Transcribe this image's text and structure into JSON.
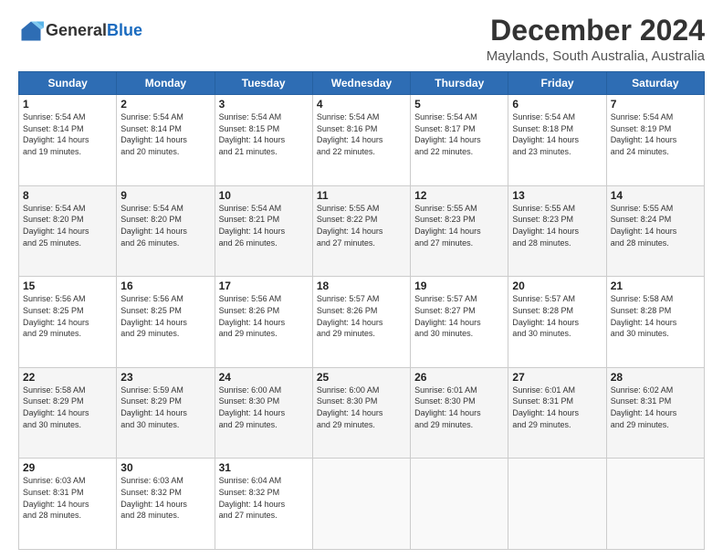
{
  "logo": {
    "line1": "General",
    "line2": "Blue"
  },
  "title": "December 2024",
  "subtitle": "Maylands, South Australia, Australia",
  "days_of_week": [
    "Sunday",
    "Monday",
    "Tuesday",
    "Wednesday",
    "Thursday",
    "Friday",
    "Saturday"
  ],
  "weeks": [
    [
      {
        "day": "1",
        "info": "Sunrise: 5:54 AM\nSunset: 8:14 PM\nDaylight: 14 hours\nand 19 minutes."
      },
      {
        "day": "2",
        "info": "Sunrise: 5:54 AM\nSunset: 8:14 PM\nDaylight: 14 hours\nand 20 minutes."
      },
      {
        "day": "3",
        "info": "Sunrise: 5:54 AM\nSunset: 8:15 PM\nDaylight: 14 hours\nand 21 minutes."
      },
      {
        "day": "4",
        "info": "Sunrise: 5:54 AM\nSunset: 8:16 PM\nDaylight: 14 hours\nand 22 minutes."
      },
      {
        "day": "5",
        "info": "Sunrise: 5:54 AM\nSunset: 8:17 PM\nDaylight: 14 hours\nand 22 minutes."
      },
      {
        "day": "6",
        "info": "Sunrise: 5:54 AM\nSunset: 8:18 PM\nDaylight: 14 hours\nand 23 minutes."
      },
      {
        "day": "7",
        "info": "Sunrise: 5:54 AM\nSunset: 8:19 PM\nDaylight: 14 hours\nand 24 minutes."
      }
    ],
    [
      {
        "day": "8",
        "info": "Sunrise: 5:54 AM\nSunset: 8:20 PM\nDaylight: 14 hours\nand 25 minutes."
      },
      {
        "day": "9",
        "info": "Sunrise: 5:54 AM\nSunset: 8:20 PM\nDaylight: 14 hours\nand 26 minutes."
      },
      {
        "day": "10",
        "info": "Sunrise: 5:54 AM\nSunset: 8:21 PM\nDaylight: 14 hours\nand 26 minutes."
      },
      {
        "day": "11",
        "info": "Sunrise: 5:55 AM\nSunset: 8:22 PM\nDaylight: 14 hours\nand 27 minutes."
      },
      {
        "day": "12",
        "info": "Sunrise: 5:55 AM\nSunset: 8:23 PM\nDaylight: 14 hours\nand 27 minutes."
      },
      {
        "day": "13",
        "info": "Sunrise: 5:55 AM\nSunset: 8:23 PM\nDaylight: 14 hours\nand 28 minutes."
      },
      {
        "day": "14",
        "info": "Sunrise: 5:55 AM\nSunset: 8:24 PM\nDaylight: 14 hours\nand 28 minutes."
      }
    ],
    [
      {
        "day": "15",
        "info": "Sunrise: 5:56 AM\nSunset: 8:25 PM\nDaylight: 14 hours\nand 29 minutes."
      },
      {
        "day": "16",
        "info": "Sunrise: 5:56 AM\nSunset: 8:25 PM\nDaylight: 14 hours\nand 29 minutes."
      },
      {
        "day": "17",
        "info": "Sunrise: 5:56 AM\nSunset: 8:26 PM\nDaylight: 14 hours\nand 29 minutes."
      },
      {
        "day": "18",
        "info": "Sunrise: 5:57 AM\nSunset: 8:26 PM\nDaylight: 14 hours\nand 29 minutes."
      },
      {
        "day": "19",
        "info": "Sunrise: 5:57 AM\nSunset: 8:27 PM\nDaylight: 14 hours\nand 30 minutes."
      },
      {
        "day": "20",
        "info": "Sunrise: 5:57 AM\nSunset: 8:28 PM\nDaylight: 14 hours\nand 30 minutes."
      },
      {
        "day": "21",
        "info": "Sunrise: 5:58 AM\nSunset: 8:28 PM\nDaylight: 14 hours\nand 30 minutes."
      }
    ],
    [
      {
        "day": "22",
        "info": "Sunrise: 5:58 AM\nSunset: 8:29 PM\nDaylight: 14 hours\nand 30 minutes."
      },
      {
        "day": "23",
        "info": "Sunrise: 5:59 AM\nSunset: 8:29 PM\nDaylight: 14 hours\nand 30 minutes."
      },
      {
        "day": "24",
        "info": "Sunrise: 6:00 AM\nSunset: 8:30 PM\nDaylight: 14 hours\nand 29 minutes."
      },
      {
        "day": "25",
        "info": "Sunrise: 6:00 AM\nSunset: 8:30 PM\nDaylight: 14 hours\nand 29 minutes."
      },
      {
        "day": "26",
        "info": "Sunrise: 6:01 AM\nSunset: 8:30 PM\nDaylight: 14 hours\nand 29 minutes."
      },
      {
        "day": "27",
        "info": "Sunrise: 6:01 AM\nSunset: 8:31 PM\nDaylight: 14 hours\nand 29 minutes."
      },
      {
        "day": "28",
        "info": "Sunrise: 6:02 AM\nSunset: 8:31 PM\nDaylight: 14 hours\nand 29 minutes."
      }
    ],
    [
      {
        "day": "29",
        "info": "Sunrise: 6:03 AM\nSunset: 8:31 PM\nDaylight: 14 hours\nand 28 minutes."
      },
      {
        "day": "30",
        "info": "Sunrise: 6:03 AM\nSunset: 8:32 PM\nDaylight: 14 hours\nand 28 minutes."
      },
      {
        "day": "31",
        "info": "Sunrise: 6:04 AM\nSunset: 8:32 PM\nDaylight: 14 hours\nand 27 minutes."
      },
      {
        "day": "",
        "info": ""
      },
      {
        "day": "",
        "info": ""
      },
      {
        "day": "",
        "info": ""
      },
      {
        "day": "",
        "info": ""
      }
    ]
  ]
}
